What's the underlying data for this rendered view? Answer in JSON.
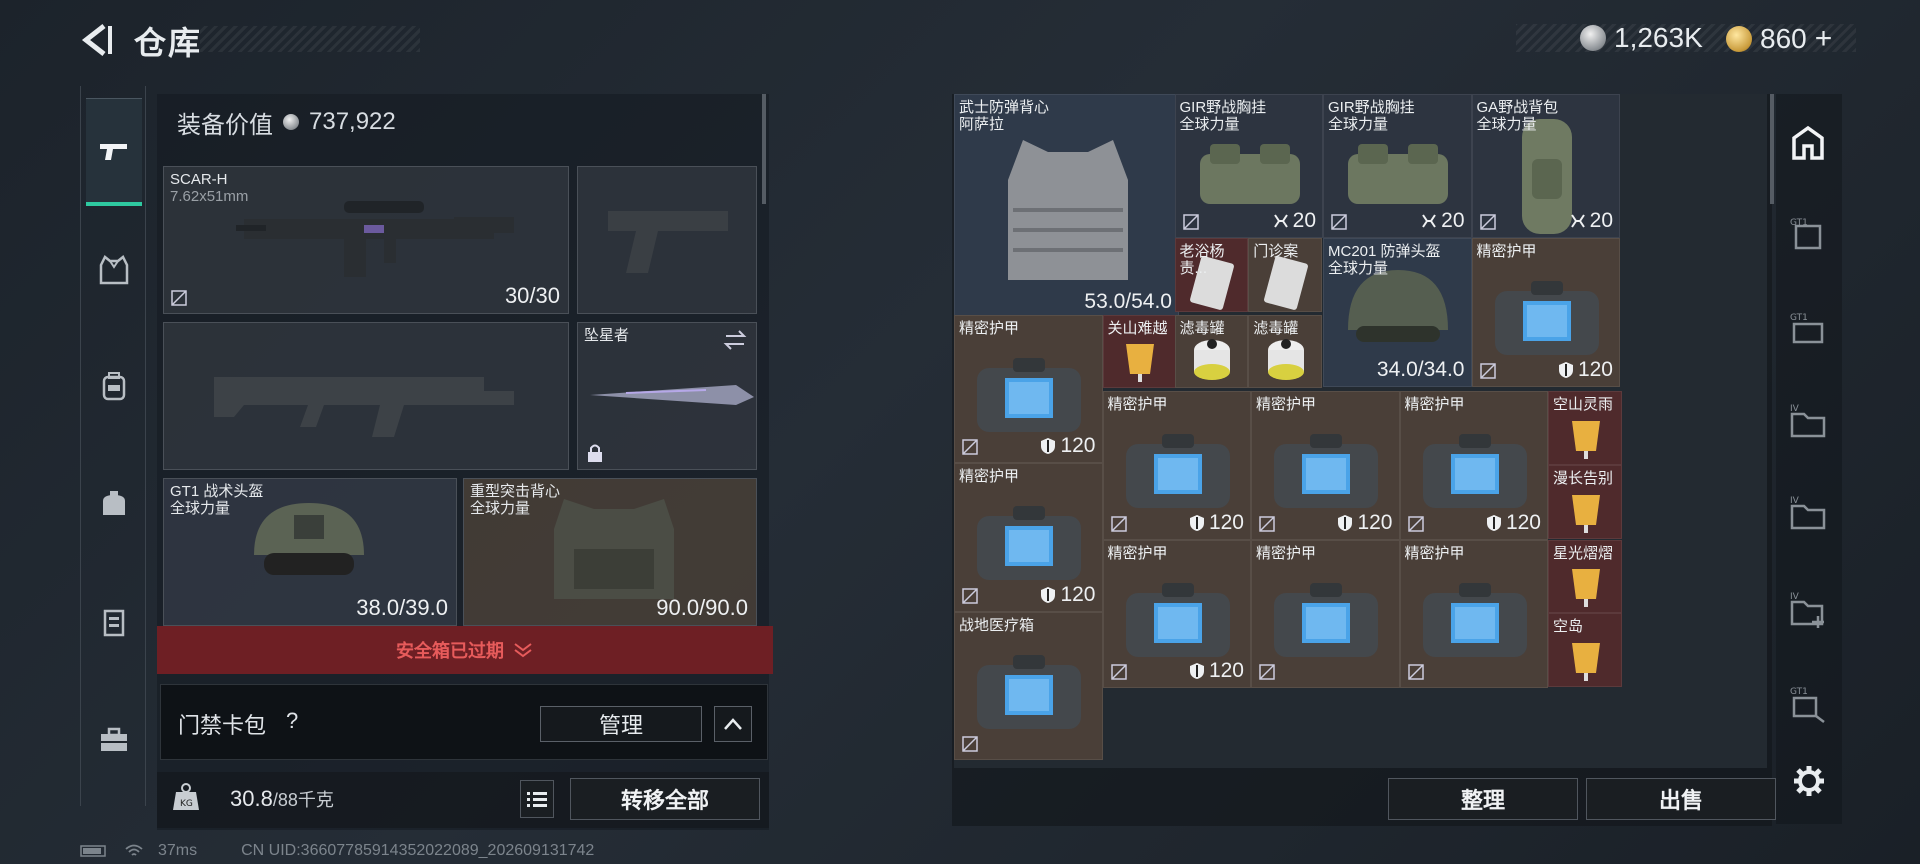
{
  "header": {
    "title": "仓库",
    "silver": "1,263K",
    "gold": "860",
    "gold_plus": "+"
  },
  "nav": {
    "items": [
      "weapon",
      "armor",
      "backpack",
      "pouch",
      "medical",
      "toolbox"
    ]
  },
  "equipment": {
    "value_label": "装备价值",
    "value": "737,922",
    "primary": {
      "name": "SCAR-H",
      "caliber": "7.62x51mm",
      "ammo": "30/30"
    },
    "secondary_empty": "",
    "melee": {
      "name": "坠星者"
    },
    "helmet": {
      "name": "GT1 战术头盔",
      "brand": "全球力量",
      "durability": "38.0/39.0"
    },
    "vest": {
      "name": "重型突击背心",
      "brand": "全球力量",
      "durability": "90.0/90.0"
    }
  },
  "safebox": {
    "text": "安全箱已过期"
  },
  "keycard": {
    "label": "门禁卡包",
    "help": "?",
    "manage": "管理"
  },
  "bottom": {
    "weight": "30.8",
    "capacity": "/88千克",
    "transfer": "转移全部"
  },
  "footer": {
    "ping": "37ms",
    "uid": "CN UID:36607785914352022089_202609131742"
  },
  "storage": {
    "items": [
      {
        "name": "武士防弹背心",
        "sub": "阿萨拉",
        "value": "53.0/54.0"
      },
      {
        "name": "GIR野战胸挂",
        "sub": "全球力量",
        "value": "20"
      },
      {
        "name": "GIR野战胸挂",
        "sub": "全球力量",
        "value": "20"
      },
      {
        "name": "GA野战背包",
        "sub": "全球力量",
        "value": "20"
      },
      {
        "name": "老浴杨责...",
        "sub": "",
        "value": ""
      },
      {
        "name": "门诊案",
        "sub": "",
        "value": ""
      },
      {
        "name": "MC201 防弹头盔",
        "sub": "全球力量",
        "value": "34.0/34.0"
      },
      {
        "name": "精密护甲",
        "sub": "",
        "value": "120"
      },
      {
        "name": "精密护甲",
        "sub": "",
        "value": "120"
      },
      {
        "name": "关山难越",
        "sub": "",
        "value": ""
      },
      {
        "name": "滤毒罐",
        "sub": "",
        "value": ""
      },
      {
        "name": "滤毒罐",
        "sub": "",
        "value": ""
      },
      {
        "name": "精密护甲",
        "sub": "",
        "value": "120"
      },
      {
        "name": "精密护甲",
        "sub": "",
        "value": "120"
      },
      {
        "name": "精密护甲",
        "sub": "",
        "value": "120"
      },
      {
        "name": "空山灵雨",
        "sub": "",
        "value": ""
      },
      {
        "name": "精密护甲",
        "sub": "",
        "value": "120"
      },
      {
        "name": "漫长告别",
        "sub": "",
        "value": ""
      },
      {
        "name": "精密护甲",
        "sub": "",
        "value": "120"
      },
      {
        "name": "精密护甲",
        "sub": "",
        "value": ""
      },
      {
        "name": "精密护甲",
        "sub": "",
        "value": ""
      },
      {
        "name": "精密护甲",
        "sub": "",
        "value": ""
      },
      {
        "name": "星光熠熠",
        "sub": "",
        "value": ""
      },
      {
        "name": "战地医疗箱",
        "sub": "",
        "value": ""
      },
      {
        "name": "空岛",
        "sub": "",
        "value": ""
      }
    ]
  },
  "actions": {
    "sort": "整理",
    "sell": "出售"
  },
  "right_nav": [
    "home",
    "GT1",
    "GT1",
    "IV",
    "IV",
    "IV+",
    "GT1"
  ],
  "colors": {
    "accent": "#2ec9a0",
    "danger": "#e75b5b",
    "brown": "#4a3f38",
    "red": "#4f2a2c"
  }
}
